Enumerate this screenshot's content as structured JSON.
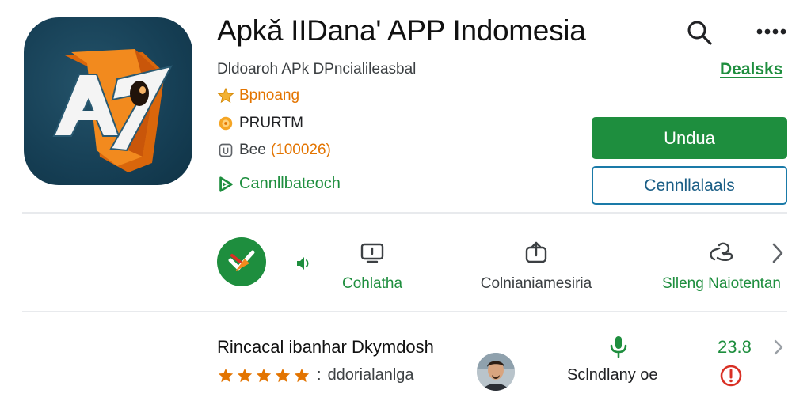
{
  "header": {
    "title": "Apkǎ IIDana' APP Indomesia",
    "subtitle": "Dldoaroh APk DPncialileasbal",
    "details_link": "Dealsks",
    "rating_text": "Bpnoang",
    "label_text": "PRURTM",
    "count_prefix": "Bee",
    "count_value": "(100026)",
    "contained_text": "Cannllbateoch",
    "icons": {
      "search": "search-icon",
      "more": "more-dots-icon",
      "rating": "star-icon",
      "label": "badge-icon",
      "count": "user-icon",
      "contained": "play-icon"
    }
  },
  "actions": {
    "install_label": "Undua",
    "secondary_label": "Cennllalaals"
  },
  "features": {
    "items": [
      {
        "label": "Cohlatha",
        "icon": "monitor-icon"
      },
      {
        "label": "Colnianiamesiria",
        "icon": "share-icon"
      },
      {
        "label": "Slleng Naiotentan",
        "icon": "link-icon"
      }
    ],
    "badge_icon": "check-arrow-icon",
    "small_icon": "audio-icon",
    "next_icon": "chevron-right-icon"
  },
  "review": {
    "title": "Rincacal ibanhar Dkymdosh",
    "stars": 5,
    "separator": ":",
    "subtitle": "ddorialanlga",
    "mic_label": "Sclndlany oe",
    "score": "23.8",
    "icons": {
      "mic": "mic-icon",
      "alert": "alert-icon",
      "next": "chevron-right-icon"
    }
  },
  "colors": {
    "accent_green": "#1e8e3e",
    "accent_orange": "#e37400",
    "outline_blue": "#1a7aa8",
    "icon_bg": "#163f55",
    "alert_red": "#d93025"
  }
}
